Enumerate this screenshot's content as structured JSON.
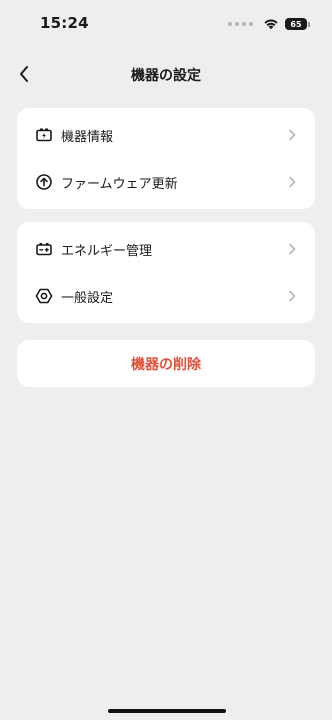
{
  "status_bar": {
    "time": "15:24",
    "battery": "65"
  },
  "header": {
    "title": "機器の設定"
  },
  "group1": {
    "items": [
      {
        "label": "機器情報",
        "icon": "battery-charge-icon"
      },
      {
        "label": "ファームウェア更新",
        "icon": "upload-circle-icon"
      }
    ]
  },
  "group2": {
    "items": [
      {
        "label": "エネルギー管理",
        "icon": "battery-level-icon"
      },
      {
        "label": "一般設定",
        "icon": "hexagon-settings-icon"
      }
    ]
  },
  "danger": {
    "delete_label": "機器の削除",
    "color": "#E0533B"
  },
  "colors": {
    "background": "#EEEEF0",
    "card": "#FFFFFF",
    "text": "#1A1A1A",
    "chevron": "#B8B8BC"
  }
}
